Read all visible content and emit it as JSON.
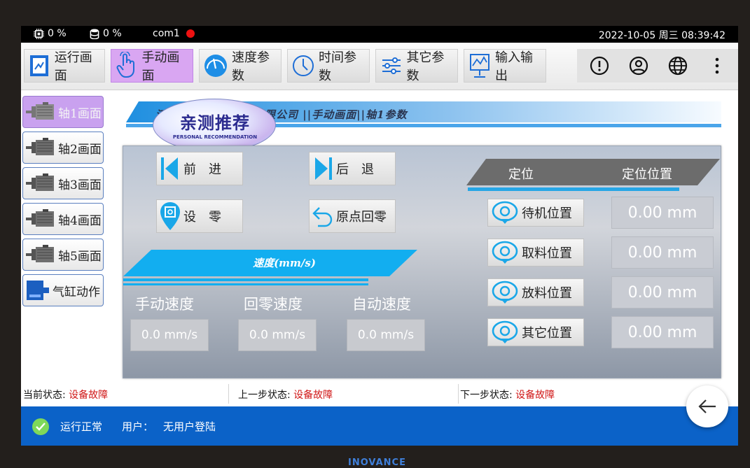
{
  "statusbar": {
    "cpu": "0 %",
    "disk": "0 %",
    "port": "com1",
    "datetime": "2022-10-05 周三 08:39:42",
    "port_status_color": "#ee1111"
  },
  "toolbar": {
    "items": [
      {
        "label": "运行画面",
        "icon": "run-screen-icon"
      },
      {
        "label": "手动画面",
        "icon": "hand-pointer-icon",
        "active": true
      },
      {
        "label": "速度参数",
        "icon": "speed-gauge-icon"
      },
      {
        "label": "时间参数",
        "icon": "clock-icon"
      },
      {
        "label": "其它参数",
        "icon": "sliders-icon"
      },
      {
        "label": "输入输出",
        "icon": "io-monitor-icon"
      }
    ],
    "right_icons": [
      "alert-icon",
      "user-icon",
      "globe-icon",
      "more-vertical-icon"
    ]
  },
  "sidebar": {
    "items": [
      {
        "label": "轴1画面",
        "icon": "motor-icon",
        "active": true
      },
      {
        "label": "轴2画面",
        "icon": "motor-icon"
      },
      {
        "label": "轴3画面",
        "icon": "motor-icon"
      },
      {
        "label": "轴4画面",
        "icon": "motor-icon"
      },
      {
        "label": "轴5画面",
        "icon": "motor-icon"
      },
      {
        "label": "气缸动作",
        "icon": "cylinder-icon"
      }
    ]
  },
  "banner": {
    "title_prefix": "汀",
    "title": "限公司 ||手动画面||轴1参数"
  },
  "stamp": {
    "main": "亲测推荐",
    "sub": "PERSONAL RECOMMENDATION"
  },
  "controls": {
    "forward_label": "前　进",
    "backward_label": "后　退",
    "zero_label": "设　零",
    "home_label": "原点回零"
  },
  "speed": {
    "header": "速度(mm/s)",
    "manual_label": "手动速度",
    "home_label": "回零速度",
    "auto_label": "自动速度",
    "manual_value": "0.0 mm/s",
    "home_value": "0.0 mm/s",
    "auto_value": "0.0 mm/s"
  },
  "positions": {
    "header_name": "定位",
    "header_value": "定位位置",
    "rows": [
      {
        "label": "待机位置",
        "value": "0.00 mm"
      },
      {
        "label": "取料位置",
        "value": "0.00 mm"
      },
      {
        "label": "放料位置",
        "value": "0.00 mm"
      },
      {
        "label": "其它位置",
        "value": "0.00 mm"
      }
    ]
  },
  "states": {
    "current_label": "当前状态:",
    "current_value": "设备故障",
    "prev_label": "上一步状态:",
    "prev_value": "设备故障",
    "next_label": "下一步状态:",
    "next_value": "设备故障"
  },
  "footer": {
    "status": "运行正常",
    "user_label": "用户：",
    "user_value": "无用户登陆"
  },
  "brand": "INOVANCE",
  "colors": {
    "active_nav": "#d9a6f2",
    "footer_blue": "#0b62c8",
    "accent_blue": "#1aa7e8",
    "fault_red": "#d01616"
  }
}
